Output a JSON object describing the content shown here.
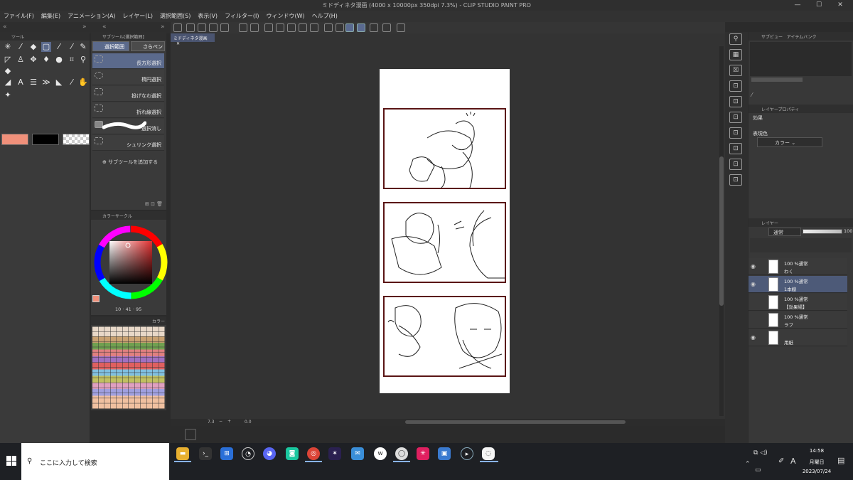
{
  "window": {
    "title": "ミドディネタ漫画 (4000 x 10000px 350dpi 7.3%)  - CLIP STUDIO PAINT PRO",
    "minimize": "—",
    "maximize": "☐",
    "close": "✕"
  },
  "menu": [
    "ファイル(F)",
    "編集(E)",
    "アニメーション(A)",
    "レイヤー(L)",
    "選択範囲(S)",
    "表示(V)",
    "フィルター(I)",
    "ウィンドウ(W)",
    "ヘルプ(H)"
  ],
  "tool_panel": {
    "title": "ツール"
  },
  "subtool_panel": {
    "title": "サブツール[選択範囲]",
    "tabs": [
      "選択範囲",
      "さらペン"
    ],
    "items": [
      "長方形選択",
      "楕円選択",
      "投げなわ選択",
      "折れ線選択",
      "選択消し",
      "シュリンク選択"
    ],
    "add_label": "サブツールを追加する"
  },
  "color_panel": {
    "title": "カラーサークル",
    "readout": [
      "10",
      "41",
      "95"
    ]
  },
  "palette_panel": {
    "title": "カラーセ"
  },
  "document": {
    "tab": "ミドディネタ漫画",
    "zoom": "7.3",
    "rotation": "0.0"
  },
  "right_panel": {
    "subview_tabs": [
      "サブビュー",
      "アイテムバンク"
    ],
    "property_title": "レイヤープロパティ",
    "effect_label": "効果",
    "expression_label": "表現色",
    "expression_value": "カラー",
    "layer_title": "レイヤー",
    "blend_mode": "通常",
    "opacity": "100",
    "layers": [
      {
        "pct": "100 %通常",
        "name": "わく"
      },
      {
        "pct": "100 %通常",
        "name": "1本線"
      },
      {
        "pct": "100 %通常",
        "name": "【効果場】"
      },
      {
        "pct": "100 %通常",
        "name": "ラフ"
      },
      {
        "pct": "",
        "name": "用紙"
      }
    ]
  },
  "taskbar": {
    "search_placeholder": "ここに入力して検索",
    "time": "14:58",
    "day": "月曜日",
    "date": "2023/07/24",
    "ime": "A"
  },
  "colors": {
    "main_color": "#f0907a",
    "sub_color": "#000000",
    "accent": "#5b6a8c"
  }
}
